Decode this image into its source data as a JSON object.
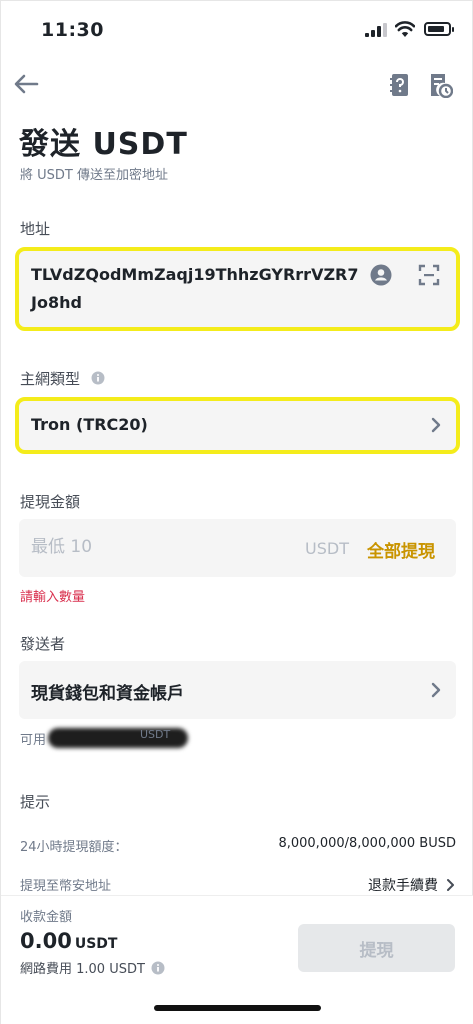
{
  "status_bar": {
    "time": "11:30"
  },
  "header": {
    "title": "發送 USDT",
    "subtitle": "將 USDT 傳送至加密地址"
  },
  "address": {
    "label": "地址",
    "value": "TLVdZQodMmZaqj19ThhzGYRrrVZR7Jo8hd"
  },
  "network": {
    "label": "主網類型",
    "selected": "Tron (TRC20)"
  },
  "amount": {
    "label": "提現金額",
    "placeholder": "最低 10",
    "unit": "USDT",
    "max_label": "全部提現",
    "error": "請輸入數量"
  },
  "sender": {
    "label": "發送者",
    "account": "現貨錢包和資金帳戶",
    "available_prefix": "可用",
    "available_unit": "USDT"
  },
  "tips": {
    "label": "提示",
    "rows": [
      {
        "key": "24小時提現額度：",
        "value": "8,000,000/8,000,000 BUSD"
      },
      {
        "key": "提現至幣安地址",
        "link": "退款手續費"
      }
    ]
  },
  "footer": {
    "receive_label": "收款金額",
    "receive_amount": "0.00",
    "receive_unit": "USDT",
    "fee_text": "網路費用 1.00 USDT",
    "withdraw_button": "提現"
  },
  "colors": {
    "accent": "#c99400",
    "highlight": "#f4ec1b",
    "error": "#d9304e",
    "field_bg": "#f5f5f5"
  }
}
